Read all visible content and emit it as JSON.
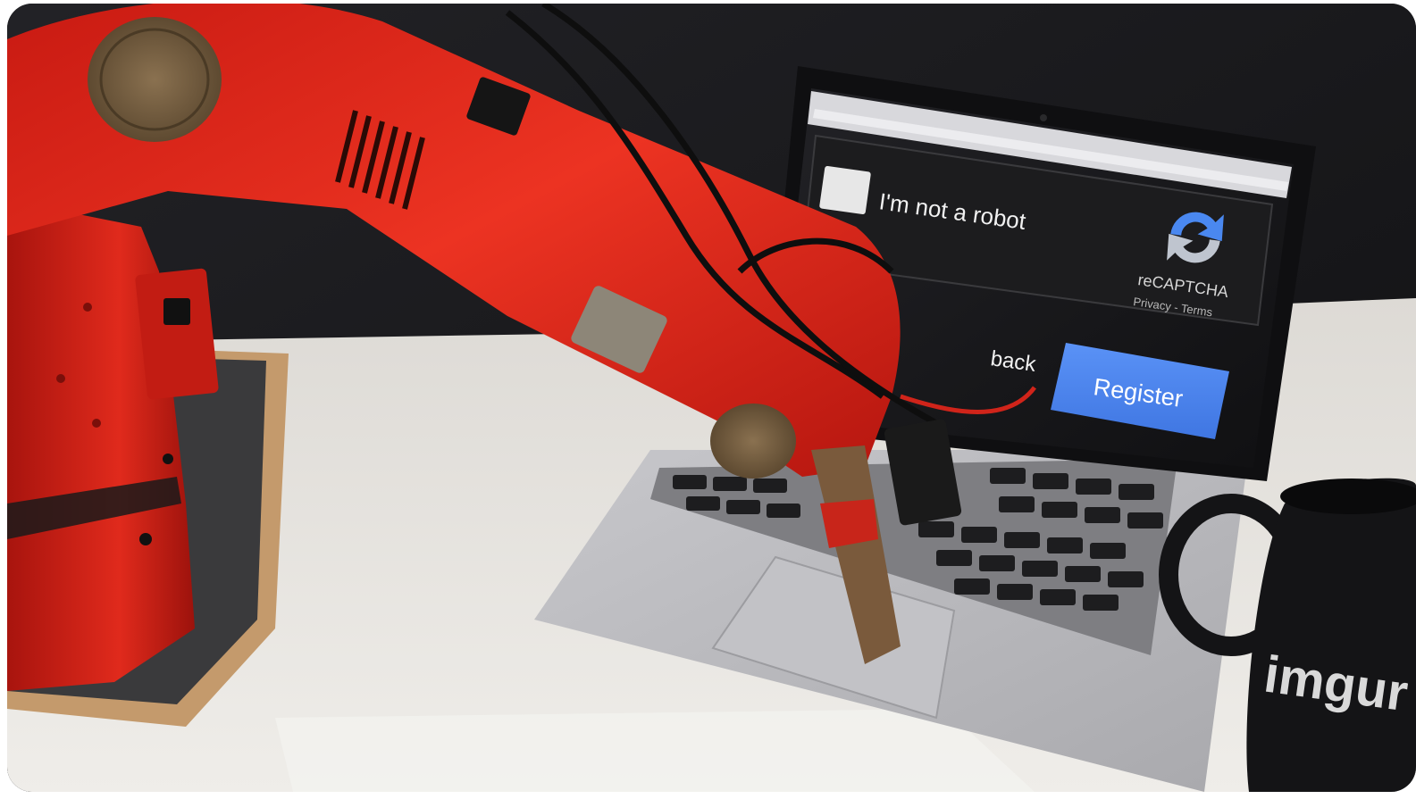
{
  "captcha": {
    "checkbox_label": "I'm not a robot",
    "brand": "reCAPTCHA",
    "links": "Privacy - Terms"
  },
  "form": {
    "back_label": "back",
    "register_label": "Register"
  },
  "mug": {
    "logo_text": "imgur"
  },
  "colors": {
    "robot_arm": "#e0261a",
    "register_button": "#4a84f0",
    "laptop_body": "#b9b9bd",
    "screen_bg": "#151517",
    "table": "#e7e5e1",
    "mug": "#141416"
  }
}
